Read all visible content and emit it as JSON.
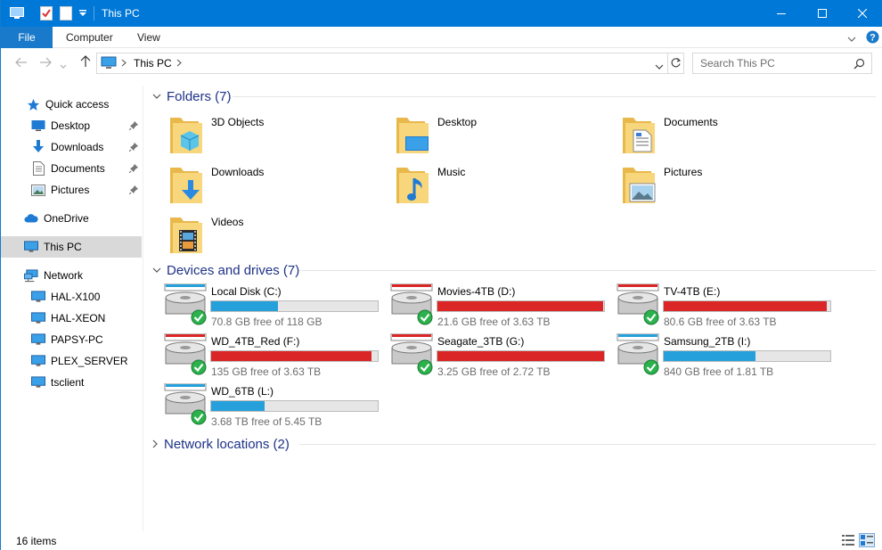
{
  "window": {
    "title": "This PC"
  },
  "ribbon": {
    "file": "File",
    "tabs": [
      "Computer",
      "View"
    ]
  },
  "address": {
    "crumb": "This PC"
  },
  "search": {
    "placeholder": "Search This PC"
  },
  "sidebar": {
    "items": [
      {
        "label": "Quick access",
        "icon": "star-icon",
        "pinned": false
      },
      {
        "label": "Desktop",
        "icon": "desktop-icon",
        "pinned": true
      },
      {
        "label": "Downloads",
        "icon": "download-arrow-icon",
        "pinned": true
      },
      {
        "label": "Documents",
        "icon": "document-icon",
        "pinned": true
      },
      {
        "label": "Pictures",
        "icon": "picture-icon",
        "pinned": true
      },
      {
        "label": "OneDrive",
        "icon": "cloud-icon",
        "pinned": false
      },
      {
        "label": "This PC",
        "icon": "monitor-icon",
        "pinned": false
      },
      {
        "label": "Network",
        "icon": "network-icon",
        "pinned": false
      },
      {
        "label": "HAL-X100",
        "icon": "monitor-icon",
        "pinned": false
      },
      {
        "label": "HAL-XEON",
        "icon": "monitor-icon",
        "pinned": false
      },
      {
        "label": "PAPSY-PC",
        "icon": "monitor-icon",
        "pinned": false
      },
      {
        "label": "PLEX_SERVER",
        "icon": "monitor-icon",
        "pinned": false
      },
      {
        "label": "tsclient",
        "icon": "monitor-icon",
        "pinned": false
      }
    ]
  },
  "groups": {
    "folders": "Folders (7)",
    "drives": "Devices and drives (7)",
    "network": "Network locations (2)"
  },
  "folders": [
    {
      "label": "3D Objects",
      "icon": "3d-cube-icon"
    },
    {
      "label": "Desktop",
      "icon": "desktop-icon"
    },
    {
      "label": "Documents",
      "icon": "document-icon"
    },
    {
      "label": "Downloads",
      "icon": "download-arrow-icon"
    },
    {
      "label": "Music",
      "icon": "music-note-icon"
    },
    {
      "label": "Pictures",
      "icon": "picture-icon"
    },
    {
      "label": "Videos",
      "icon": "film-icon"
    }
  ],
  "drives": [
    {
      "name": "Local Disk (C:)",
      "free": "70.8 GB free of 118 GB",
      "used_fraction": 0.4,
      "critical": false
    },
    {
      "name": "Movies-4TB (D:)",
      "free": "21.6 GB free of 3.63 TB",
      "used_fraction": 0.994,
      "critical": true
    },
    {
      "name": "TV-4TB (E:)",
      "free": "80.6 GB free of 3.63 TB",
      "used_fraction": 0.978,
      "critical": true
    },
    {
      "name": "WD_4TB_Red (F:)",
      "free": "135 GB free of 3.63 TB",
      "used_fraction": 0.964,
      "critical": true
    },
    {
      "name": "Seagate_3TB (G:)",
      "free": "3.25 GB free of 2.72 TB",
      "used_fraction": 0.999,
      "critical": true
    },
    {
      "name": "Samsung_2TB (I:)",
      "free": "840 GB free of 1.81 TB",
      "used_fraction": 0.55,
      "critical": false
    },
    {
      "name": "WD_6TB (L:)",
      "free": "3.68 TB free of 5.45 TB",
      "used_fraction": 0.32,
      "critical": false
    }
  ],
  "status": {
    "count": "16 items"
  },
  "colors": {
    "accent": "#0078d7",
    "bar_normal": "#26a0da",
    "bar_critical": "#da2626",
    "group_heading": "#1e3287"
  }
}
